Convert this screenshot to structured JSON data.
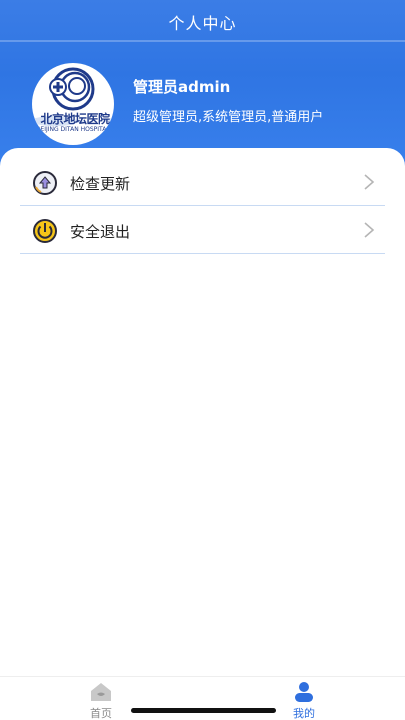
{
  "header": {
    "title": "个人中心"
  },
  "profile": {
    "logo_text": "北京地坛医院",
    "logo_subtext": "BEIJING DITAN HOSPITAL",
    "name": "管理员admin",
    "roles": "超级管理员,系统管理员,普通用户"
  },
  "menu": {
    "items": [
      {
        "label": "检查更新",
        "icon": "update-icon"
      },
      {
        "label": "安全退出",
        "icon": "power-icon"
      }
    ]
  },
  "tabbar": {
    "tabs": [
      {
        "label": "首页",
        "icon": "home-icon",
        "active": false
      },
      {
        "label": "我的",
        "icon": "user-icon",
        "active": true
      }
    ]
  },
  "colors": {
    "header_blue": "#2f75e3",
    "active_tab": "#2f6fde",
    "divider": "#c8daf3"
  }
}
